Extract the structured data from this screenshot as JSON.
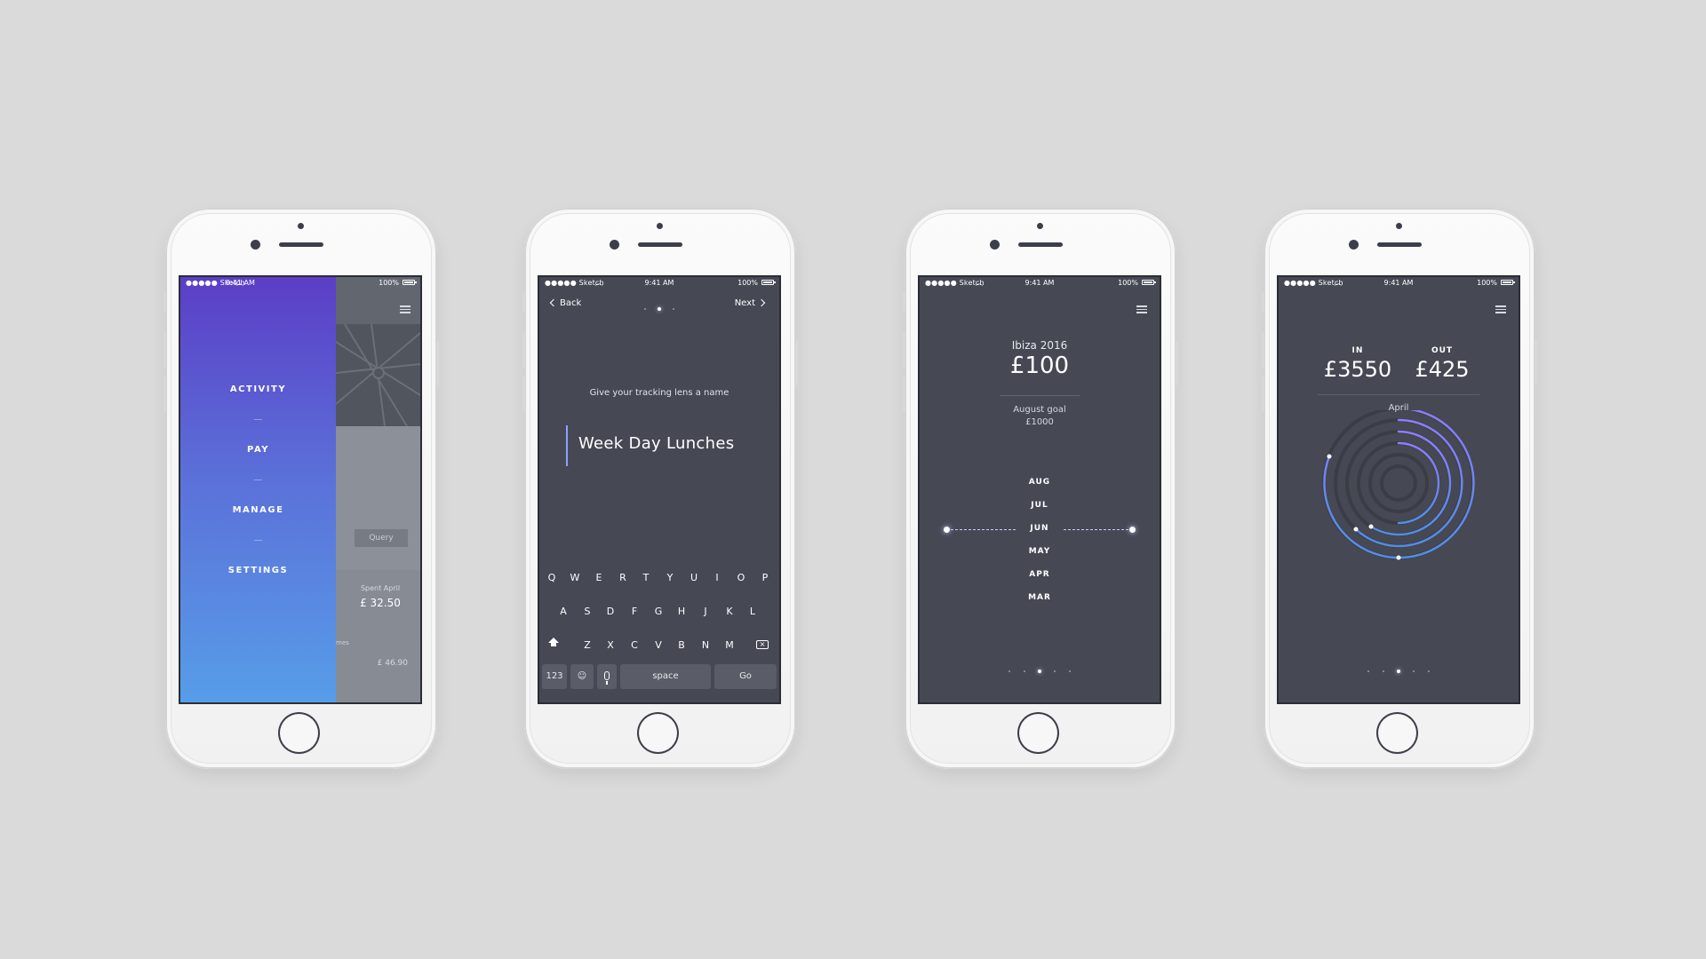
{
  "status_bar": {
    "carrier": "●●●●● Sketch",
    "time": "9:41 AM",
    "battery": "100%"
  },
  "phone1": {
    "menu": [
      "ACTIVITY",
      "PAY",
      "MANAGE",
      "SETTINGS"
    ],
    "query_button": "Query",
    "spent_label": "Spent April",
    "spent_value": "£ 32.50",
    "row_fragment": "mes",
    "row_value": "£ 46.90"
  },
  "phone2": {
    "back": "Back",
    "next": "Next",
    "prompt": "Give your tracking lens a name",
    "input_value": "Week Day Lunches",
    "keyboard": {
      "row1": [
        "Q",
        "W",
        "E",
        "R",
        "T",
        "Y",
        "U",
        "I",
        "O",
        "P"
      ],
      "row2": [
        "A",
        "S",
        "D",
        "F",
        "G",
        "H",
        "J",
        "K",
        "L"
      ],
      "row3": [
        "Z",
        "X",
        "C",
        "V",
        "B",
        "N",
        "M"
      ],
      "numbers": "123",
      "space": "space",
      "go": "Go"
    }
  },
  "phone3": {
    "goal_name": "Ibiza 2016",
    "amount": "£100",
    "goal_label": "August goal",
    "goal_value": "£1000",
    "months": [
      "AUG",
      "JUL",
      "JUN",
      "MAY",
      "APR",
      "MAR"
    ],
    "selected_month": "JUN"
  },
  "phone4": {
    "in_label": "IN",
    "in_value": "£3550",
    "out_label": "OUT",
    "out_value": "£425",
    "month": "April"
  },
  "colors": {
    "screen_bg": "#464954",
    "accent": "#7b8cff",
    "drawer_top": "#5b3ec6",
    "drawer_bottom": "#579de8"
  },
  "icons": [
    "menu-icon",
    "back-chevron-icon",
    "next-chevron-icon",
    "shift-icon",
    "backspace-icon",
    "emoji-icon",
    "microphone-icon",
    "wifi-icon",
    "battery-icon"
  ]
}
